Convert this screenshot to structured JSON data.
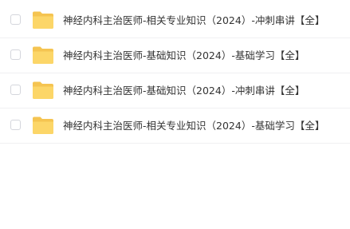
{
  "files": [
    {
      "name": "神经内科主治医师-相关专业知识（2024）-冲刺串讲【全】",
      "icon": "folder-icon",
      "checked": false
    },
    {
      "name": "神经内科主治医师-基础知识（2024）-基础学习【全】",
      "icon": "folder-icon",
      "checked": false
    },
    {
      "name": "神经内科主治医师-基础知识（2024）-冲刺串讲【全】",
      "icon": "folder-icon",
      "checked": false
    },
    {
      "name": "神经内科主治医师-相关专业知识（2024）-基础学习【全】",
      "icon": "folder-icon",
      "checked": false
    }
  ],
  "colors": {
    "folder_back": "#f5c451",
    "folder_front": "#fcd668",
    "text": "#333333",
    "divider": "#f0f0f2",
    "checkbox_border": "#d4d6dc"
  }
}
